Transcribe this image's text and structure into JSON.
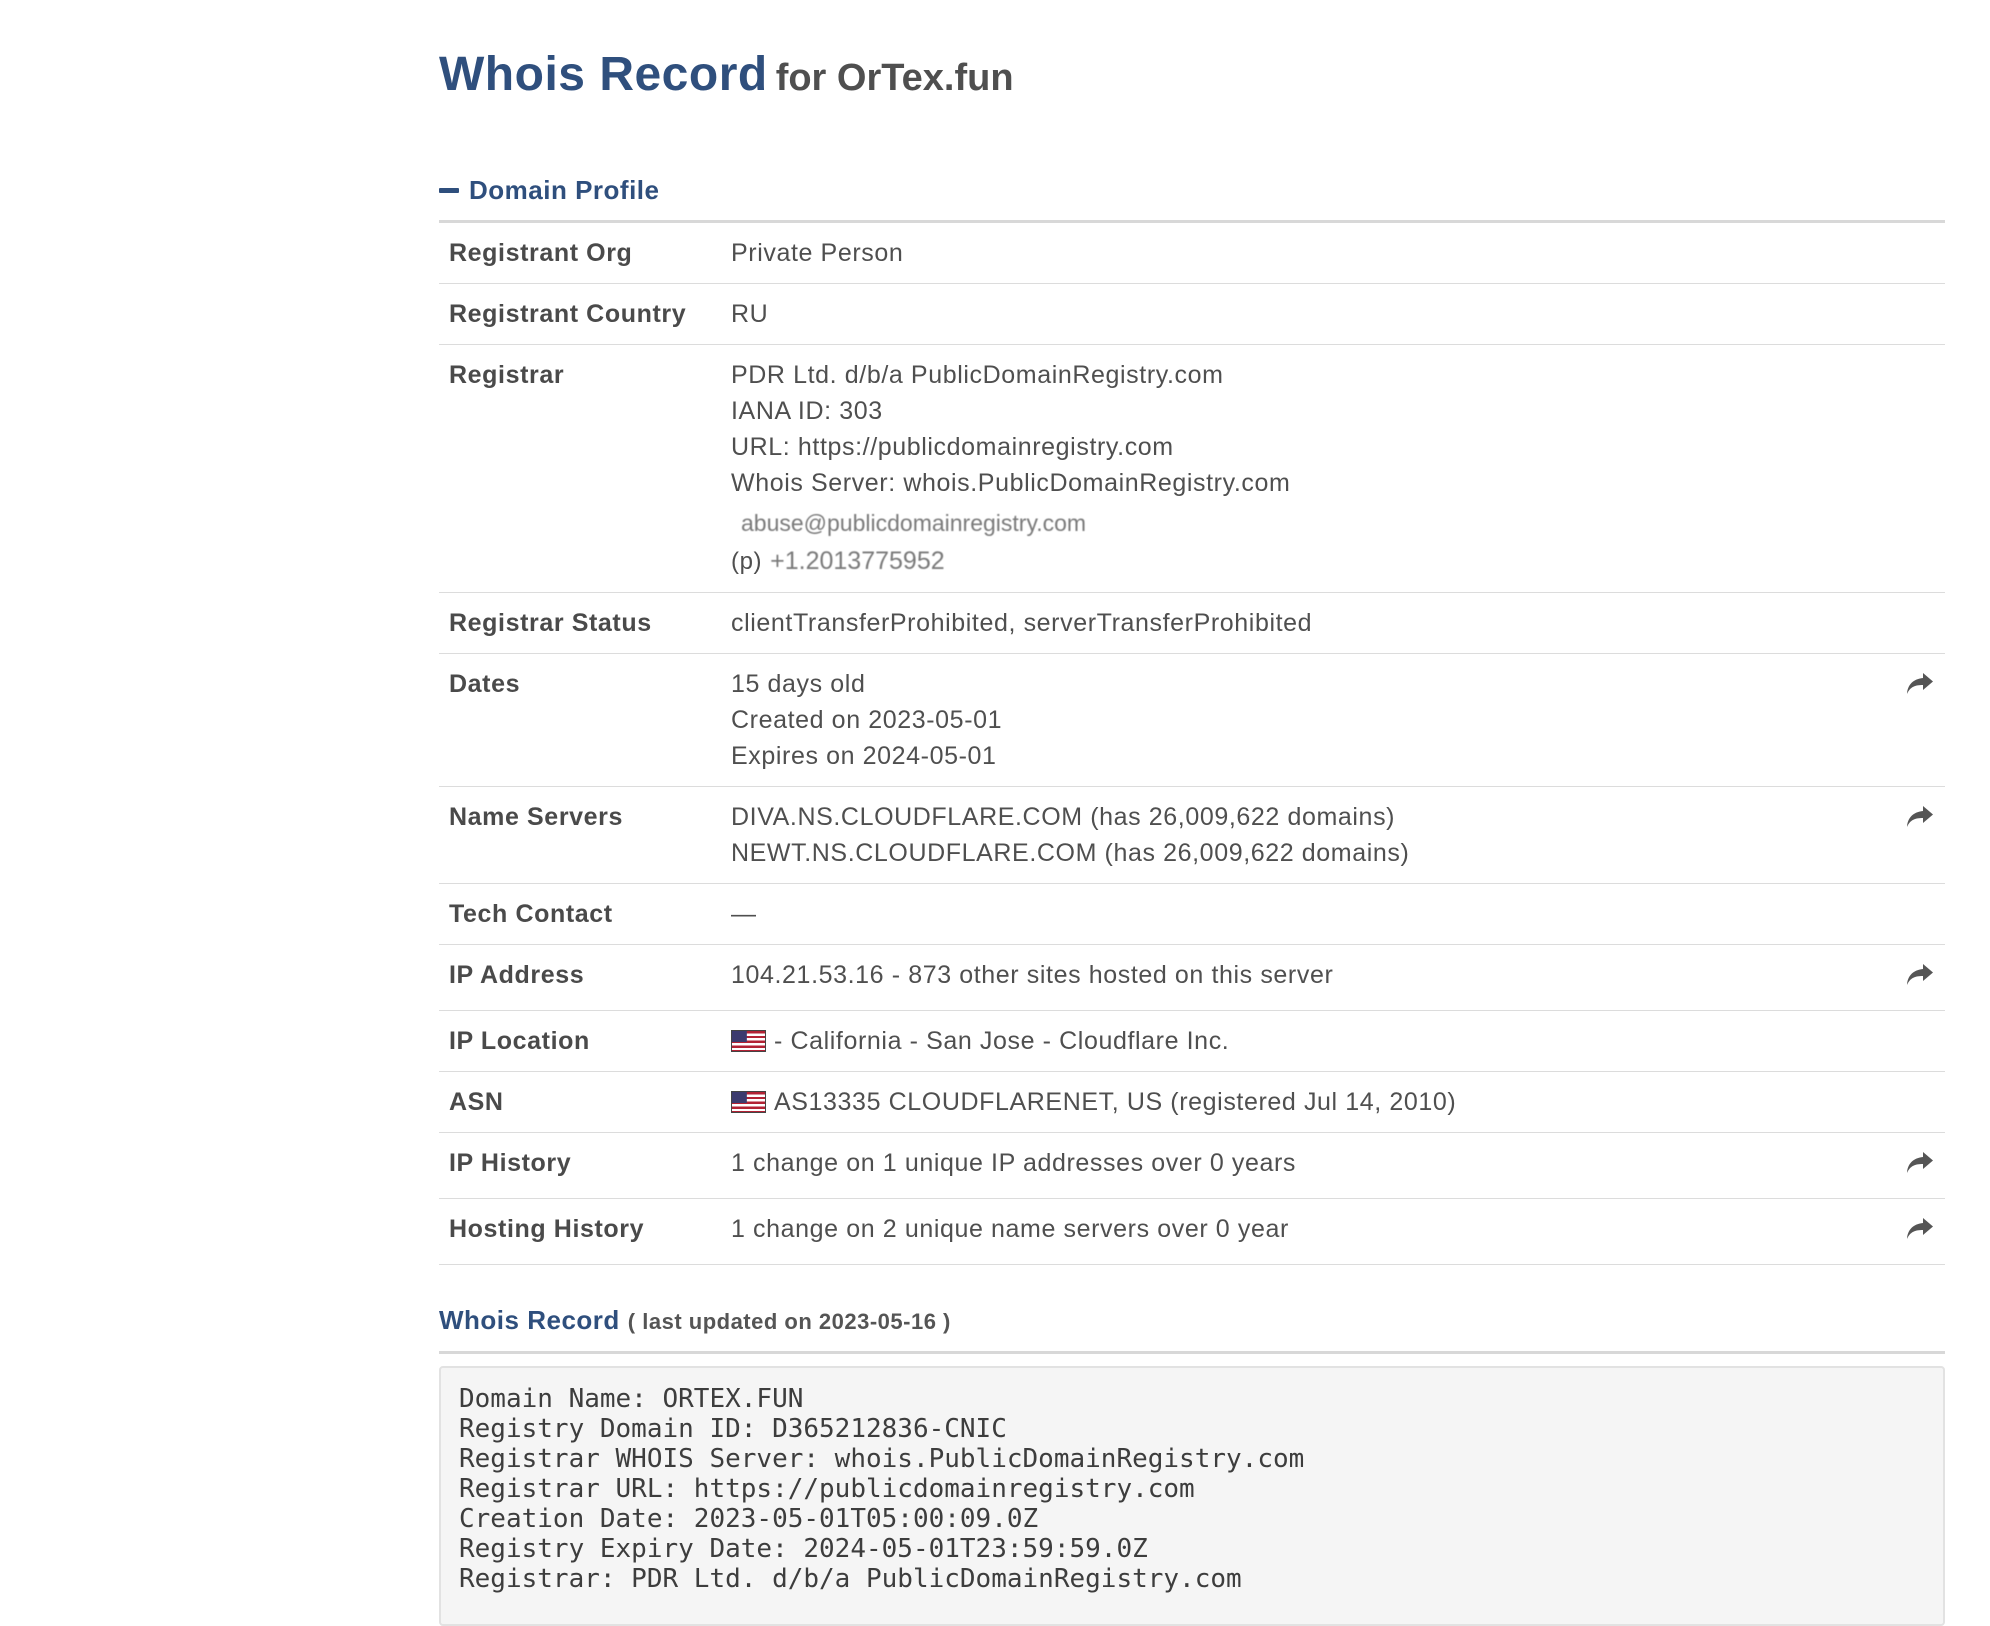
{
  "page": {
    "title_main": "Whois Record",
    "title_sub": "for OrTex.fun"
  },
  "profile": {
    "section_title": "Domain Profile",
    "rows": {
      "registrant_org": {
        "label": "Registrant Org",
        "value": "Private Person"
      },
      "registrant_country": {
        "label": "Registrant Country",
        "value": "RU"
      },
      "registrar": {
        "label": "Registrar",
        "name": "PDR Ltd. d/b/a PublicDomainRegistry.com",
        "iana": "IANA ID: 303",
        "url": "URL: https://publicdomainregistry.com",
        "whois_server": "Whois Server: whois.PublicDomainRegistry.com",
        "email": "abuse@publicdomainregistry.com",
        "phone_prefix": "(p)",
        "phone": "+1.2013775952"
      },
      "registrar_status": {
        "label": "Registrar Status",
        "value": "clientTransferProhibited, serverTransferProhibited"
      },
      "dates": {
        "label": "Dates",
        "age": "15 days old",
        "created": "Created on 2023-05-01",
        "expires": "Expires on 2024-05-01"
      },
      "name_servers": {
        "label": "Name Servers",
        "ns1": "DIVA.NS.CLOUDFLARE.COM (has 26,009,622 domains)",
        "ns2": "NEWT.NS.CLOUDFLARE.COM (has 26,009,622 domains)"
      },
      "tech_contact": {
        "label": "Tech Contact",
        "value": "—"
      },
      "ip_address": {
        "label": "IP Address",
        "value": "104.21.53.16 - 873 other sites hosted on this server"
      },
      "ip_location": {
        "label": "IP Location",
        "value": "- California - San Jose - Cloudflare Inc."
      },
      "asn": {
        "label": "ASN",
        "value": "AS13335 CLOUDFLARENET, US (registered Jul 14, 2010)"
      },
      "ip_history": {
        "label": "IP History",
        "value": "1 change on 1 unique IP addresses over 0 years"
      },
      "hosting_history": {
        "label": "Hosting History",
        "value": "1 change on 2 unique name servers over 0 year"
      }
    }
  },
  "whois": {
    "title": "Whois Record",
    "updated": "( last updated on 2023-05-16 )",
    "lines": [
      "Domain Name: ORTEX.FUN",
      "Registry Domain ID: D365212836-CNIC",
      "Registrar WHOIS Server: whois.PublicDomainRegistry.com",
      "Registrar URL: https://publicdomainregistry.com",
      "Creation Date: 2023-05-01T05:00:09.0Z",
      "Registry Expiry Date: 2024-05-01T23:59:59.0Z",
      "Registrar: PDR Ltd. d/b/a PublicDomainRegistry.com"
    ]
  },
  "icons": {
    "share": "share-arrow-icon",
    "collapse": "minus-icon",
    "flag": "us-flag-icon"
  }
}
